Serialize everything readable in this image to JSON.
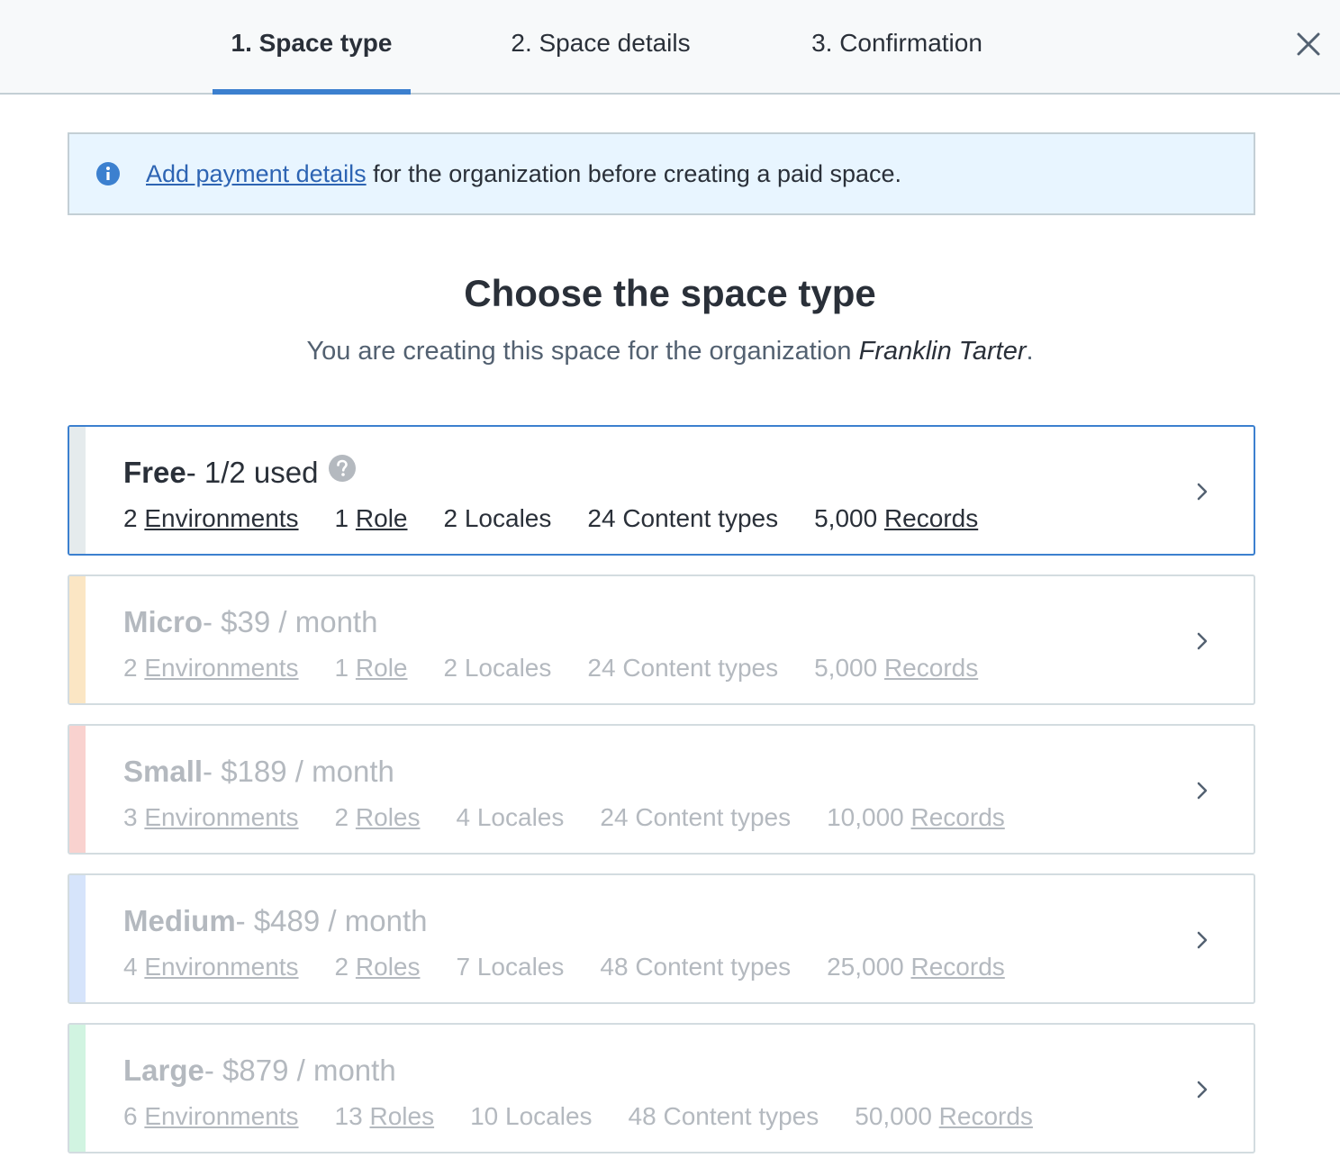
{
  "steps": [
    {
      "label": "1. Space type",
      "active": true
    },
    {
      "label": "2. Space details",
      "active": false
    },
    {
      "label": "3. Confirmation",
      "active": false
    }
  ],
  "note": {
    "link": "Add payment details",
    "text": " for the organization before creating a paid space."
  },
  "heading": "Choose the space type",
  "subheading": {
    "prefix": "You are creating this space for the organization ",
    "org": "Franklin Tarter",
    "suffix": "."
  },
  "plans": [
    {
      "name": "Free",
      "detail": " - 1/2 used",
      "color": "#e5ebed",
      "selected": true,
      "disabled": false,
      "features": [
        {
          "num": "2 ",
          "label": "Environments",
          "link": true
        },
        {
          "num": "1 ",
          "label": "Role",
          "link": true
        },
        {
          "num": "2 ",
          "label": "Locales",
          "link": false
        },
        {
          "num": "24 ",
          "label": "Content types",
          "link": false
        },
        {
          "num": "5,000 ",
          "label": "Records",
          "link": true
        }
      ]
    },
    {
      "name": "Micro",
      "detail": " - $39 / month",
      "color": "#fbe6c4",
      "selected": false,
      "disabled": true,
      "features": [
        {
          "num": "2 ",
          "label": "Environments",
          "link": true
        },
        {
          "num": "1 ",
          "label": "Role",
          "link": true
        },
        {
          "num": "2 ",
          "label": "Locales",
          "link": false
        },
        {
          "num": "24 ",
          "label": "Content types",
          "link": false
        },
        {
          "num": "5,000 ",
          "label": "Records",
          "link": true
        }
      ]
    },
    {
      "name": "Small",
      "detail": " - $189 / month",
      "color": "#f9d2cf",
      "selected": false,
      "disabled": true,
      "features": [
        {
          "num": "3 ",
          "label": "Environments",
          "link": true
        },
        {
          "num": "2 ",
          "label": "Roles",
          "link": true
        },
        {
          "num": "4 ",
          "label": "Locales",
          "link": false
        },
        {
          "num": "24 ",
          "label": "Content types",
          "link": false
        },
        {
          "num": "10,000 ",
          "label": "Records",
          "link": true
        }
      ]
    },
    {
      "name": "Medium",
      "detail": " - $489 / month",
      "color": "#d6e4fb",
      "selected": false,
      "disabled": true,
      "features": [
        {
          "num": "4 ",
          "label": "Environments",
          "link": true
        },
        {
          "num": "2 ",
          "label": "Roles",
          "link": true
        },
        {
          "num": "7 ",
          "label": "Locales",
          "link": false
        },
        {
          "num": "48 ",
          "label": "Content types",
          "link": false
        },
        {
          "num": "25,000 ",
          "label": "Records",
          "link": true
        }
      ]
    },
    {
      "name": "Large",
      "detail": " - $879 / month",
      "color": "#d1f4e1",
      "selected": false,
      "disabled": true,
      "features": [
        {
          "num": "6 ",
          "label": "Environments",
          "link": true
        },
        {
          "num": "13 ",
          "label": "Roles",
          "link": true
        },
        {
          "num": "10 ",
          "label": "Locales",
          "link": false
        },
        {
          "num": "48 ",
          "label": "Content types",
          "link": false
        },
        {
          "num": "50,000 ",
          "label": "Records",
          "link": true
        }
      ]
    }
  ],
  "icons": {
    "close": "close-icon",
    "info": "info-icon",
    "help": "help-icon",
    "chevron": "chevron-right-icon"
  },
  "colors": {
    "accent": "#3c80cf",
    "note_bg": "#e8f5ff",
    "link": "#2d64b3"
  }
}
